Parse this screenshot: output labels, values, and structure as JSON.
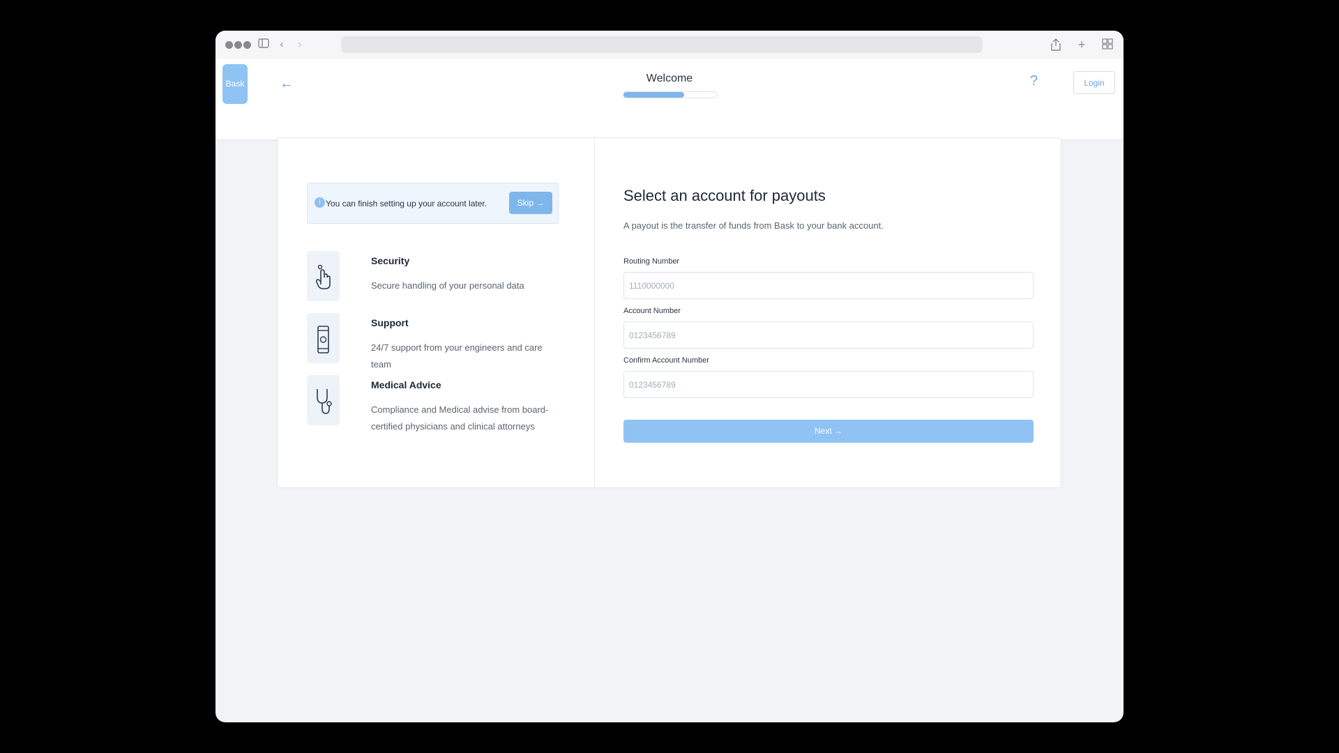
{
  "app": {
    "logo_text": "Bask",
    "welcome": "Welcome",
    "progress": 0.65,
    "help_label": "?",
    "login_label": "Login"
  },
  "notice": {
    "text": "You can finish setting up your account later.",
    "skip_label": "Skip →"
  },
  "features": [
    {
      "title": "Security",
      "desc": "Secure handling of your personal data",
      "icon": "hand-pointer-icon"
    },
    {
      "title": "Support",
      "desc": "24/7 support from your engineers and care team",
      "icon": "phone-icon"
    },
    {
      "title": "Medical Advice",
      "desc": "Compliance and Medical advise from board-certified physicians and clinical attorneys",
      "icon": "stethoscope-icon"
    }
  ],
  "form": {
    "title": "Select an account for payouts",
    "subtitle": "A payout is the transfer of funds from Bask to your bank account.",
    "routing": {
      "label": "Routing Number",
      "placeholder": "1110000000"
    },
    "account": {
      "label": "Account Number",
      "placeholder": "0123456789"
    },
    "confirm": {
      "label": "Confirm Account Number",
      "placeholder": "0123456789"
    },
    "next_label": "Next →"
  },
  "colors": {
    "accent": "#7fb6ec",
    "accent_light": "#8fc3f4",
    "text_dark": "#1e2838",
    "text_muted": "#5b6472"
  }
}
